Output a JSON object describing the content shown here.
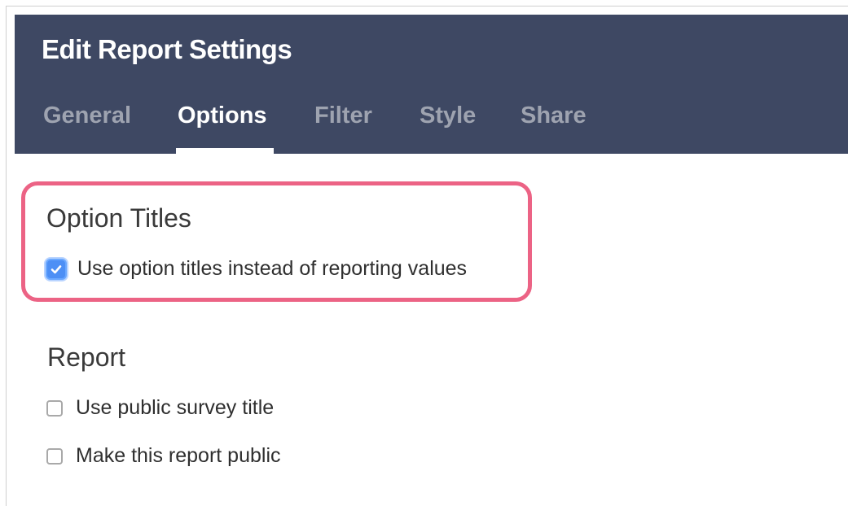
{
  "dialog": {
    "title": "Edit Report Settings"
  },
  "tabs": [
    {
      "label": "General",
      "active": false
    },
    {
      "label": "Options",
      "active": true
    },
    {
      "label": "Filter",
      "active": false
    },
    {
      "label": "Style",
      "active": false
    },
    {
      "label": "Share",
      "active": false
    }
  ],
  "option_titles": {
    "heading": "Option Titles",
    "use_option_titles": {
      "label": "Use option titles instead of reporting values",
      "checked": true
    }
  },
  "report": {
    "heading": "Report",
    "use_public_title": {
      "label": "Use public survey title",
      "checked": false
    },
    "make_public": {
      "label": "Make this report public",
      "checked": false
    }
  },
  "colors": {
    "header_bg": "#3e4863",
    "highlight_border": "#ec6385",
    "checkbox_checked": "#4d8ff5",
    "inactive_tab": "#9ea3b0"
  },
  "icons": {
    "checkmark": "checkmark-icon"
  }
}
